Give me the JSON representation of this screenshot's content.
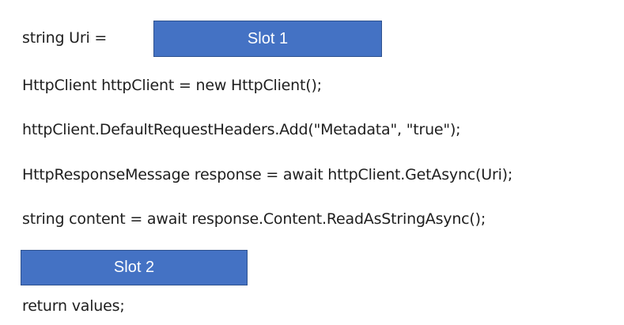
{
  "code": {
    "line1_prefix": "string Uri =",
    "line2": "HttpClient httpClient = new HttpClient();",
    "line3": "httpClient.DefaultRequestHeaders.Add(\"Metadata\", \"true\");",
    "line4": "HttpResponseMessage response = await httpClient.GetAsync(Uri);",
    "line5": "string content = await response.Content.ReadAsStringAsync();",
    "line6": "return values;"
  },
  "slots": {
    "slot1_label": "Slot 1",
    "slot2_label": "Slot 2"
  },
  "colors": {
    "slot_fill": "#4472c4",
    "slot_border": "#2f528f",
    "slot_text": "#ffffff",
    "code_text": "#1e1e1e"
  }
}
